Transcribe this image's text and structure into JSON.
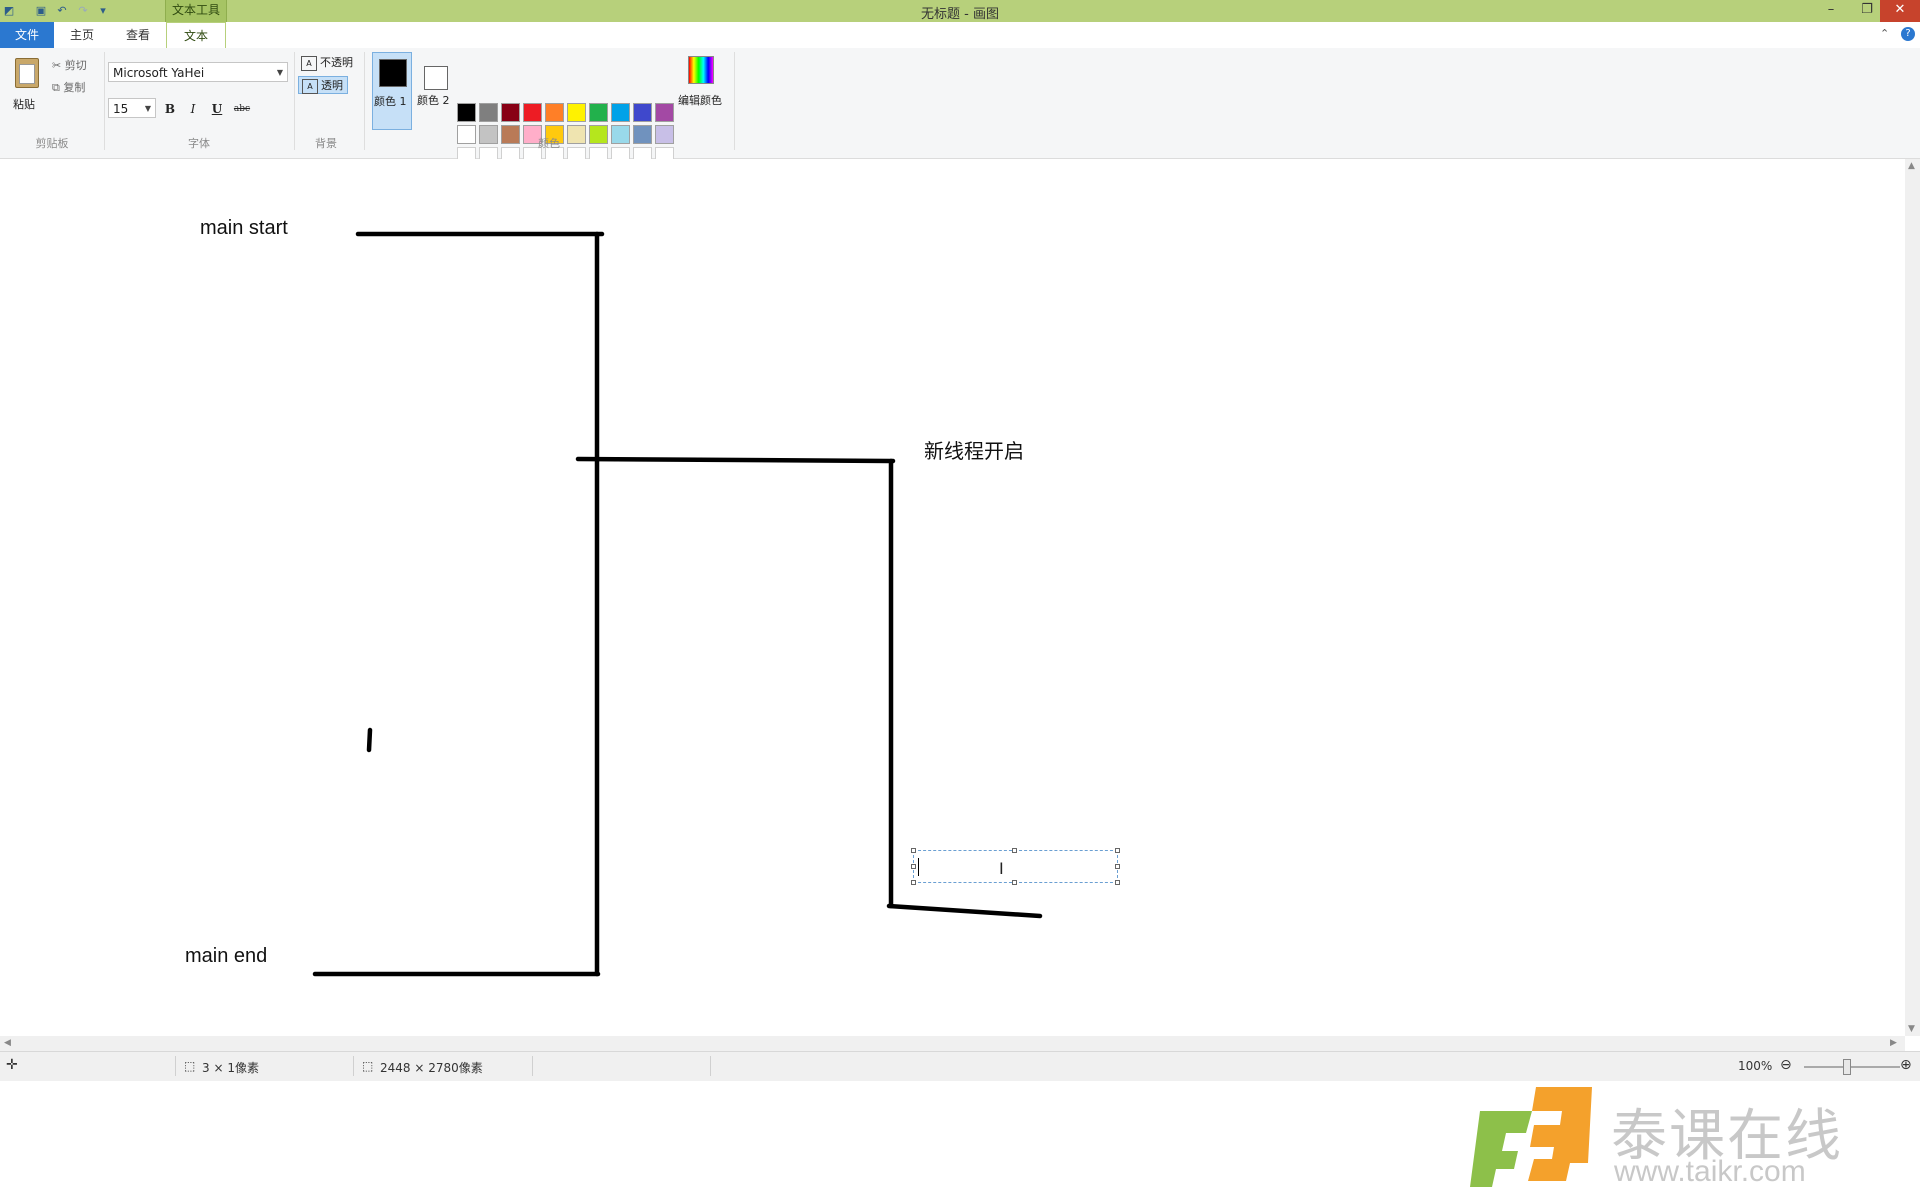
{
  "window": {
    "title": "无标题 - 画图",
    "contextual_tab": "文本工具",
    "controls": {
      "minimize": "–",
      "restore": "❐",
      "close": "✕"
    }
  },
  "tabs": [
    {
      "label": "文件"
    },
    {
      "label": "主页"
    },
    {
      "label": "查看"
    },
    {
      "label": "文本"
    }
  ],
  "ribbon": {
    "clipboard": {
      "paste": "粘贴",
      "cut": "剪切",
      "copy": "复制",
      "group": "剪贴板"
    },
    "font": {
      "family": "Microsoft YaHei",
      "size": "15",
      "bold": "B",
      "italic": "I",
      "underline": "U",
      "strike": "abc",
      "group": "字体"
    },
    "background": {
      "opaque": "不透明",
      "transparent": "透明",
      "group": "背景"
    },
    "colors": {
      "color1": "颜色 1",
      "color2": "颜色 2",
      "edit": "编辑颜色",
      "group": "颜色",
      "color1_value": "#000000",
      "color2_value": "#ffffff",
      "palette_row1": [
        "#000000",
        "#7f7f7f",
        "#880015",
        "#ed1c24",
        "#ff7f27",
        "#fff200",
        "#22b14c",
        "#00a2e8",
        "#3f48cc",
        "#a349a4"
      ],
      "palette_row2": [
        "#ffffff",
        "#c3c3c3",
        "#b97a57",
        "#ffaec9",
        "#ffc90e",
        "#efe4b0",
        "#b5e61d",
        "#99d9ea",
        "#7092be",
        "#c8bfe7"
      ]
    }
  },
  "canvas": {
    "texts": {
      "main_start": "main start",
      "new_thread": "新线程开启",
      "main_end": "main end"
    }
  },
  "status": {
    "selection": "3 × 1像素",
    "canvas_size": "2448 × 2780像素",
    "zoom": "100%"
  },
  "watermark": {
    "brand": "泰课在线",
    "url": "www.taikr.com"
  }
}
